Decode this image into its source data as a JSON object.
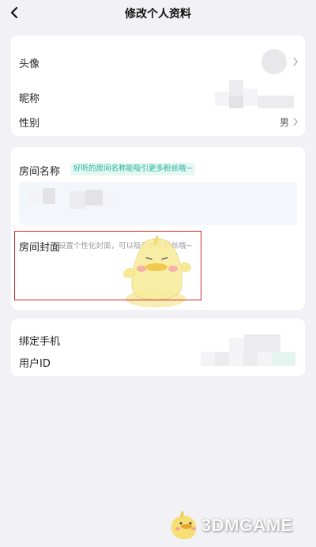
{
  "header": {
    "title": "修改个人资料"
  },
  "profile": {
    "avatar_label": "头像",
    "nickname_label": "昵称",
    "gender_label": "性别",
    "gender_value": "男"
  },
  "room": {
    "name_label": "房间名称",
    "name_tip": "好听的房间名称能吸引更多粉丝哦~",
    "cover_label": "房间封面",
    "cover_hint": "设置个性化封面，可以吸引更多粉丝哦~"
  },
  "account": {
    "phone_label": "绑定手机",
    "userid_label": "用户ID"
  },
  "watermark": {
    "text": "3DMGAME"
  },
  "colors": {
    "accent": "#1fb39a",
    "highlight": "#cf2a2a",
    "background": "#f1f1f6"
  }
}
